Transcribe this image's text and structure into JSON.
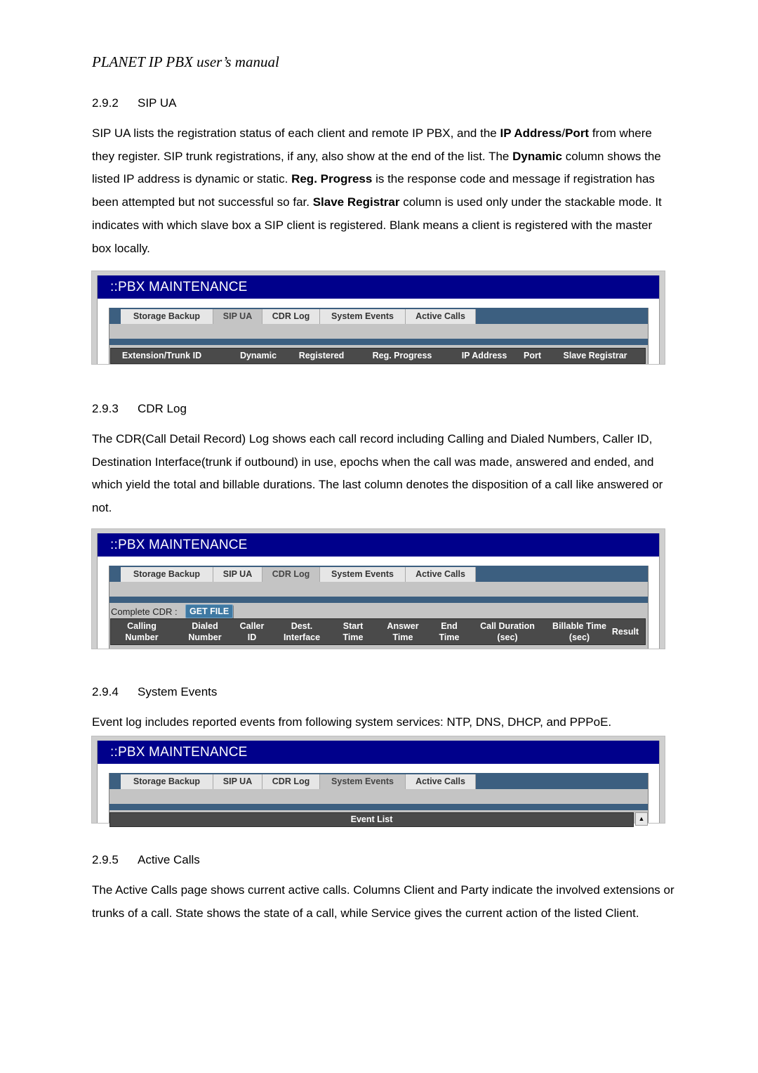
{
  "running_header": "PLANET IP PBX user’s manual",
  "sections": [
    {
      "number": "2.9.2",
      "title": "SIP UA",
      "paragraph_html": "SIP UA lists the registration status of each client and remote IP PBX, and the <b>IP Address</b>/<b>Port</b> from where they register. SIP trunk registrations, if any, also show at the end of the list. The <b>Dynamic</b> column shows the listed IP address is dynamic or static. <b>Reg. Progress</b> is the response code and message if registration has been attempted but not successful so far. <b>Slave Registrar</b> column is used only under the stackable mode. It indicates with which slave box a SIP client is registered. Blank means a client is registered with the master box locally."
    },
    {
      "number": "2.9.3",
      "title": "CDR Log",
      "paragraph_html": "The CDR(Call Detail Record) Log shows each call record including Calling and Dialed Numbers, Caller ID, Destination Interface(trunk if outbound) in use, epochs when the call was made, answered and ended, and which yield the total and billable durations. The last column denotes the disposition of a call like answered or not."
    },
    {
      "number": "2.9.4",
      "title": "System Events",
      "paragraph_html": "Event log includes reported events from following system services: NTP, DNS, DHCP, and PPPoE."
    },
    {
      "number": "2.9.5",
      "title": "Active Calls",
      "paragraph_html": "The Active Calls page shows current active calls. Columns Client and Party indicate the involved extensions or trunks of a call. State shows the state of a call, while Service gives the current action of the listed Client."
    }
  ],
  "screenshots": {
    "title": "::PBX MAINTENANCE",
    "tabs": [
      "Storage Backup",
      "SIP UA",
      "CDR Log",
      "System Events",
      "Active Calls"
    ],
    "sip_ua": {
      "active_tab": "SIP UA",
      "columns": [
        "Extension/Trunk ID",
        "Dynamic",
        "Registered",
        "Reg. Progress",
        "IP Address",
        "Port",
        "Slave Registrar"
      ]
    },
    "cdr_log": {
      "active_tab": "CDR Log",
      "complete_cdr_label": "Complete CDR :",
      "get_file_label": "GET FILE",
      "columns": [
        [
          "Calling",
          "Number"
        ],
        [
          "Dialed",
          "Number"
        ],
        [
          "Caller",
          "ID"
        ],
        [
          "Dest.",
          "Interface"
        ],
        [
          "Start",
          "Time"
        ],
        [
          "Answer",
          "Time"
        ],
        [
          "End",
          "Time"
        ],
        [
          "Call Duration",
          "(sec)"
        ],
        [
          "Billable Time",
          "(sec)"
        ],
        [
          "Result",
          ""
        ]
      ]
    },
    "system_events": {
      "active_tab": "System Events",
      "list_header": "Event List",
      "scroll_icon": "▲"
    }
  }
}
